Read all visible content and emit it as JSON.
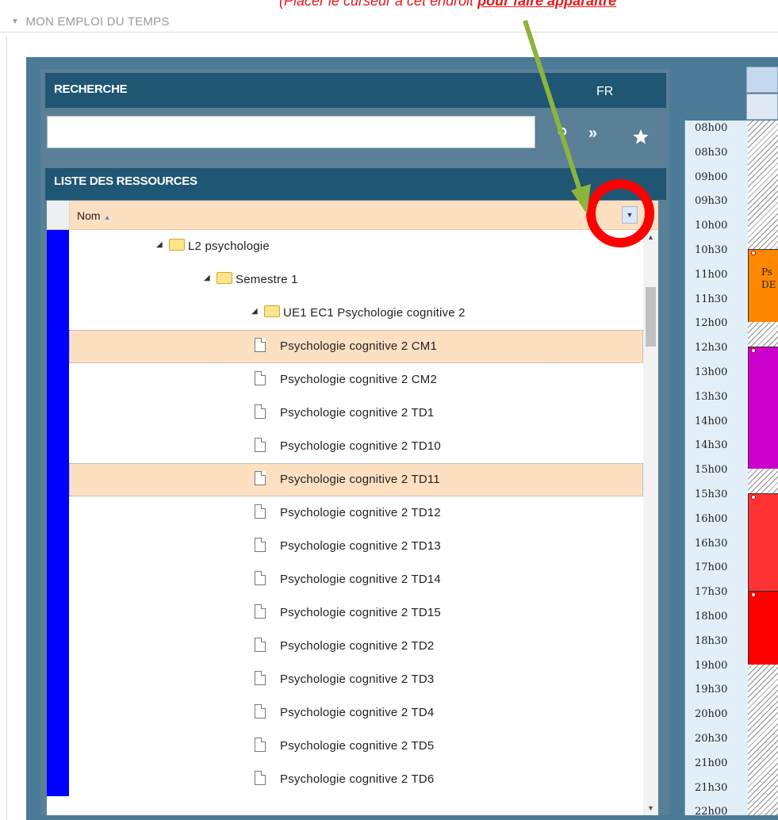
{
  "section": {
    "title": "MON EMPLOI DU TEMPS"
  },
  "annotation": {
    "text_before": "(Placer le curseur à cet endroit ",
    "text_bold": "pour faire apparaître"
  },
  "search": {
    "header": "RECHERCHE",
    "lang": "FR",
    "input_value": "",
    "icons": [
      "search-icon",
      "double-chevron-right-icon",
      "star-icon"
    ]
  },
  "resources": {
    "header": "LISTE DES RESSOURCES",
    "column_name": "Nom",
    "rows": [
      {
        "label": "L2 psychologie",
        "type": "folder",
        "level": 1,
        "selected": false
      },
      {
        "label": "Semestre 1",
        "type": "folder",
        "level": 2,
        "selected": false
      },
      {
        "label": "UE1 EC1 Psychologie cognitive 2",
        "type": "folder",
        "level": 3,
        "selected": false
      },
      {
        "label": "Psychologie cognitive 2 CM1",
        "type": "document",
        "level": 4,
        "selected": true
      },
      {
        "label": "Psychologie cognitive 2 CM2",
        "type": "document",
        "level": 4,
        "selected": false
      },
      {
        "label": "Psychologie cognitive 2 TD1",
        "type": "document",
        "level": 4,
        "selected": false
      },
      {
        "label": "Psychologie cognitive 2 TD10",
        "type": "document",
        "level": 4,
        "selected": false
      },
      {
        "label": "Psychologie cognitive 2 TD11",
        "type": "document",
        "level": 4,
        "selected": true
      },
      {
        "label": "Psychologie cognitive 2 TD12",
        "type": "document",
        "level": 4,
        "selected": false
      },
      {
        "label": "Psychologie cognitive 2 TD13",
        "type": "document",
        "level": 4,
        "selected": false
      },
      {
        "label": "Psychologie cognitive 2 TD14",
        "type": "document",
        "level": 4,
        "selected": false
      },
      {
        "label": "Psychologie cognitive 2 TD15",
        "type": "document",
        "level": 4,
        "selected": false
      },
      {
        "label": "Psychologie cognitive 2 TD2",
        "type": "document",
        "level": 4,
        "selected": false
      },
      {
        "label": "Psychologie cognitive 2 TD3",
        "type": "document",
        "level": 4,
        "selected": false
      },
      {
        "label": "Psychologie cognitive 2 TD4",
        "type": "document",
        "level": 4,
        "selected": false
      },
      {
        "label": "Psychologie cognitive 2 TD5",
        "type": "document",
        "level": 4,
        "selected": false
      },
      {
        "label": "Psychologie cognitive 2 TD6",
        "type": "document",
        "level": 4,
        "selected": false
      }
    ]
  },
  "calendar": {
    "times": [
      "08h00",
      "08h30",
      "09h00",
      "09h30",
      "10h00",
      "10h30",
      "11h00",
      "11h30",
      "12h00",
      "12h30",
      "13h00",
      "13h30",
      "14h00",
      "14h30",
      "15h00",
      "15h30",
      "16h00",
      "16h30",
      "17h00",
      "17h30",
      "18h00",
      "18h30",
      "19h00",
      "19h30",
      "20h00",
      "20h30",
      "21h00",
      "21h30",
      "22h00"
    ],
    "events": [
      {
        "start": "10h30",
        "end": "12h00",
        "color": "#ff8800",
        "text1": "Ps",
        "text2": "DE"
      },
      {
        "start": "12h30",
        "end": "15h00",
        "color": "#cc00cc",
        "text1": "",
        "text2": ""
      },
      {
        "start": "15h30",
        "end": "17h30",
        "color": "#ff3333",
        "text1": "",
        "text2": ""
      },
      {
        "start": "17h30",
        "end": "19h00",
        "color": "#ff0000",
        "text1": "",
        "text2": ""
      }
    ]
  },
  "colors": {
    "header_bg": "#1f5674",
    "panel_bg": "#5a7f96",
    "selected_row": "#fde0c1",
    "row_marker": "#0000ff",
    "annotation": "#e8171b",
    "arrow": "#8cb43e",
    "highlight_circle": "#ff0000"
  }
}
